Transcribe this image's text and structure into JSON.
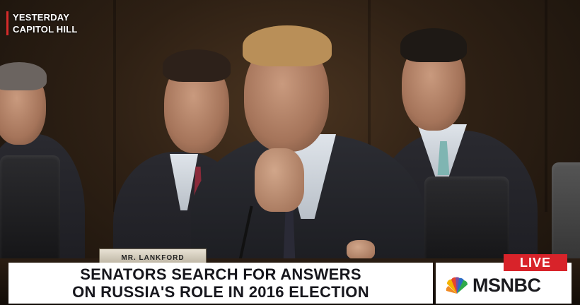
{
  "location_bug": {
    "line1": "YESTERDAY",
    "line2": "CAPITOL HILL"
  },
  "nameplate": {
    "text": "MR. LANKFORD"
  },
  "lower_third": {
    "headline_line1": "SENATORS SEARCH FOR ANSWERS",
    "headline_line2": "ON RUSSIA'S ROLE IN 2016 ELECTION"
  },
  "network": {
    "live_label": "LIVE",
    "name": "MSNBC",
    "logo_icon": "peacock-icon"
  },
  "colors": {
    "live_red": "#d8232a",
    "bug_accent": "#d62b2b",
    "banner_bg": "#ffffff",
    "headline_text": "#16161c"
  }
}
